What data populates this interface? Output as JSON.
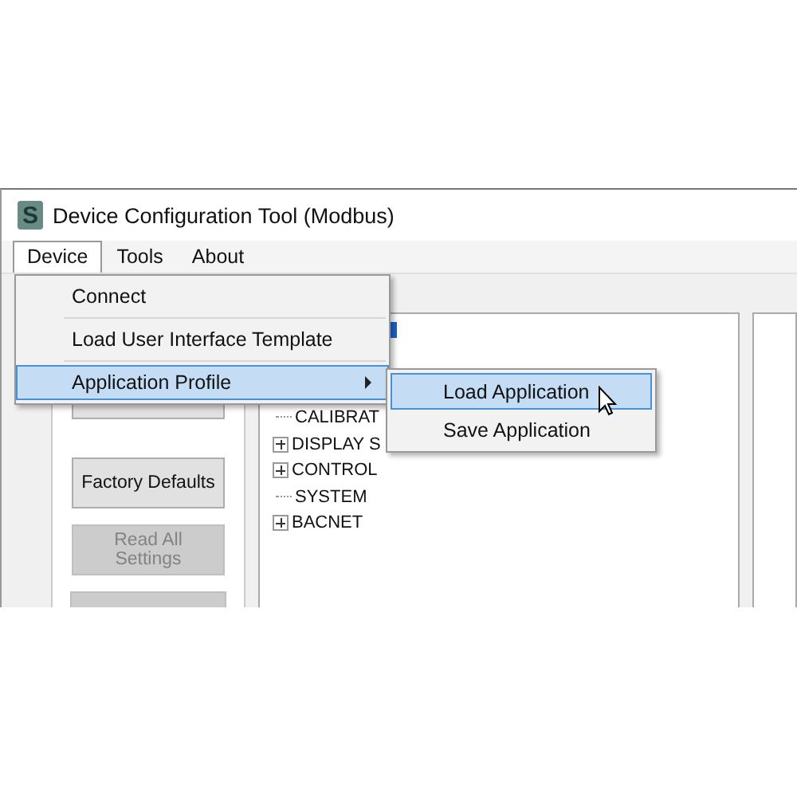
{
  "window": {
    "logo": "S",
    "title": "Device Configuration Tool (Modbus)"
  },
  "menu_bar": [
    {
      "label": "Device",
      "selected": true
    },
    {
      "label": "Tools",
      "selected": false
    },
    {
      "label": "About",
      "selected": false
    }
  ],
  "device_menu": [
    {
      "label": "Connect",
      "selected": false,
      "submenu": false
    },
    {
      "label": "Load User Interface Template",
      "selected": false,
      "submenu": false
    },
    {
      "label": "Application Profile",
      "selected": true,
      "submenu": true
    }
  ],
  "application_profile_menu": [
    {
      "label": "Load Application",
      "selected": true
    },
    {
      "label": "Save Application",
      "selected": false
    }
  ],
  "buttons": [
    {
      "label": "Factory Defaults",
      "disabled": false
    },
    {
      "label": "Read All Settings",
      "disabled": true
    }
  ],
  "tree": [
    {
      "label": "CALIBRAT",
      "kind": "leaf"
    },
    {
      "label": "DISPLAY S",
      "kind": "node"
    },
    {
      "label": "CONTROL",
      "kind": "node"
    },
    {
      "label": "SYSTEM",
      "kind": "leaf"
    },
    {
      "label": "BACNET",
      "kind": "node"
    }
  ]
}
